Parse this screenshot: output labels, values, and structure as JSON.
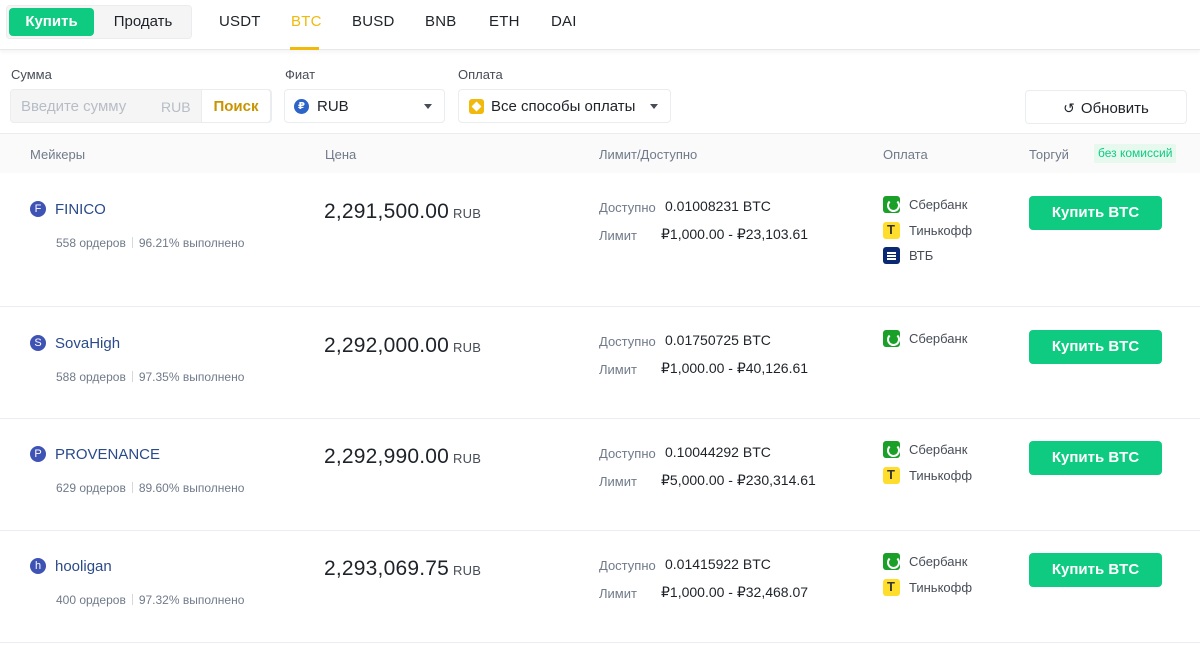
{
  "top": {
    "buy_label": "Купить",
    "sell_label": "Продать",
    "asset_tabs": [
      "USDT",
      "BTC",
      "BUSD",
      "BNB",
      "ETH",
      "DAI"
    ],
    "active_tab": "BTC"
  },
  "filters": {
    "amount_label": "Сумма",
    "amount_placeholder": "Введите сумму",
    "amount_unit": "RUB",
    "search_label": "Поиск",
    "fiat_label": "Фиат",
    "fiat_value": "RUB",
    "fiat_icon": "ruble-coin-icon",
    "payment_label": "Оплата",
    "payment_value": "Все способы оплаты",
    "payment_icon": "binance-icon",
    "refresh_label": "Обновить"
  },
  "table": {
    "headers": {
      "makers": "Мейкеры",
      "price": "Цена",
      "limit": "Лимит/Доступно",
      "payment": "Оплата",
      "trade": "Торгуй"
    },
    "fee_badge": "без комиссий",
    "available_label": "Доступно",
    "limit_label": "Лимит",
    "rows": [
      {
        "avatar": "F",
        "name": "FINICO",
        "orders": "558 ордеров",
        "completion": "96.21% выполнено",
        "price": "2,291,500.00",
        "price_unit": "RUB",
        "available": "0.01008231 BTC",
        "limit": "₽1,000.00 - ₽23,103.61",
        "payments": [
          "Сбербанк",
          "Тинькофф",
          "ВТБ"
        ],
        "button": "Купить BTC"
      },
      {
        "avatar": "S",
        "name": "SovaHigh",
        "orders": "588 ордеров",
        "completion": "97.35% выполнено",
        "price": "2,292,000.00",
        "price_unit": "RUB",
        "available": "0.01750725 BTC",
        "limit": "₽1,000.00 - ₽40,126.61",
        "payments": [
          "Сбербанк"
        ],
        "button": "Купить BTC"
      },
      {
        "avatar": "P",
        "name": "PROVENANCE",
        "orders": "629 ордеров",
        "completion": "89.60% выполнено",
        "price": "2,292,990.00",
        "price_unit": "RUB",
        "available": "0.10044292 BTC",
        "limit": "₽5,000.00 - ₽230,314.61",
        "payments": [
          "Сбербанк",
          "Тинькофф"
        ],
        "button": "Купить BTC"
      },
      {
        "avatar": "h",
        "name": "hooligan",
        "orders": "400 ордеров",
        "completion": "97.32% выполнено",
        "price": "2,293,069.75",
        "price_unit": "RUB",
        "available": "0.01415922 BTC",
        "limit": "₽1,000.00 - ₽32,468.07",
        "payments": [
          "Сбербанк",
          "Тинькофф"
        ],
        "button": "Купить BTC"
      }
    ]
  },
  "colors": {
    "buy_green": "#0ecb81",
    "accent_yellow": "#f0b90b",
    "link_blue": "#2a4a8a"
  }
}
